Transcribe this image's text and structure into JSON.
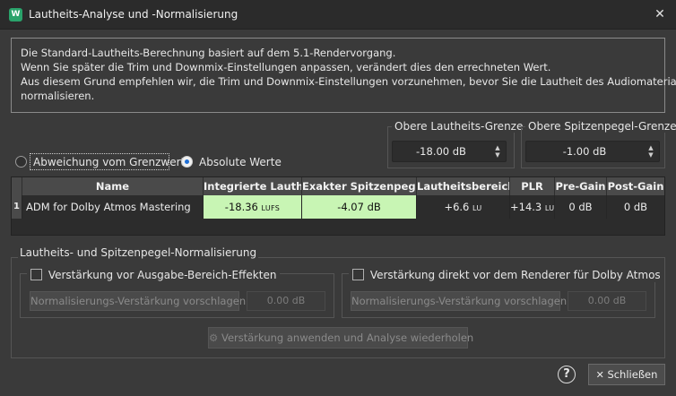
{
  "window": {
    "title": "Lautheits-Analyse und -Normalisierung",
    "app_icon_letter": "W"
  },
  "info_lines": [
    "Die Standard-Lautheits-Berechnung basiert auf dem 5.1-Rendervorgang.",
    "Wenn Sie später die Trim und Downmix-Einstellungen anpassen, verändert dies den errechneten Wert.",
    "Aus diesem Grund empfehlen wir, die Trim und Downmix-Einstellungen vorzunehmen, bevor Sie die Lautheit des Audiomaterials",
    "normalisieren."
  ],
  "limits": {
    "loudness_label": "Obere Lautheits-Grenze",
    "loudness_value": "-18.00 dB",
    "peak_label": "Obere Spitzenpegel-Grenze",
    "peak_value": "-1.00 dB"
  },
  "mode": {
    "deviation_label": "Abweichung vom Grenzwert",
    "absolute_label": "Absolute Werte",
    "selected": "Absolute Werte"
  },
  "table": {
    "headers": [
      "Name",
      "Integrierte Lautheit",
      "Exakter Spitzenpegel",
      "Lautheitsbereich",
      "PLR",
      "Pre-Gain",
      "Post-Gain"
    ],
    "rows": [
      {
        "index": "1",
        "name": "ADM for Dolby Atmos Mastering",
        "integrated_value": "-18.36",
        "integrated_unit": "LUFS",
        "true_peak": "-4.07 dB",
        "range_value": "+6.6",
        "range_unit": "LU",
        "plr_value": "+14.3",
        "plr_unit": "LU",
        "pre_gain": "0 dB",
        "post_gain": "0 dB"
      }
    ]
  },
  "normalization": {
    "title": "Lautheits- und Spitzenpegel-Normalisierung",
    "left_checkbox": "Verstärkung vor Ausgabe-Bereich-Effekten",
    "right_checkbox": "Verstärkung direkt vor dem Renderer für Dolby Atmos",
    "suggest_button": "Normalisierungs-Verstärkung vorschlagen",
    "gain_value": "0.00 dB",
    "apply_button": "Verstärkung anwenden und Analyse wiederholen"
  },
  "footer": {
    "help": "?",
    "close_label": "Schließen"
  },
  "colors": {
    "highlight_green": "#c8f5b4",
    "radio_accent": "#1f6fd6",
    "app_icon": "#2aa36b"
  }
}
